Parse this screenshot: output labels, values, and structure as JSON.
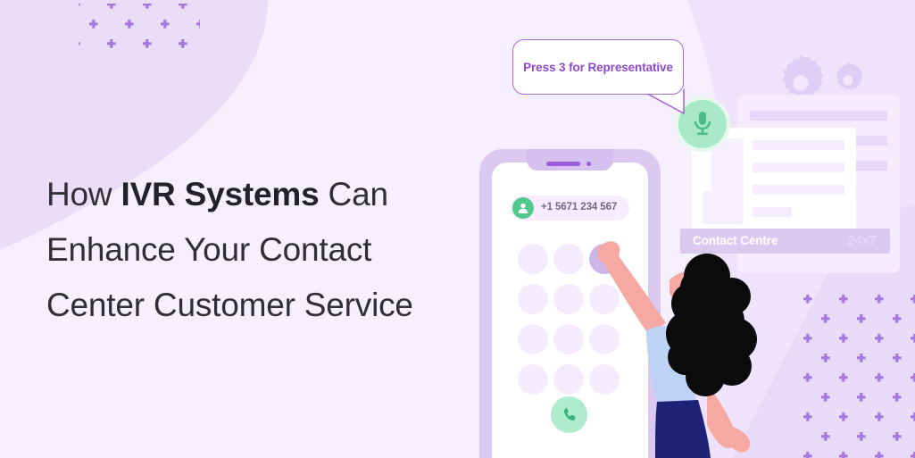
{
  "banner": {
    "headline": {
      "part1": "How ",
      "highlight": "IVR Systems",
      "part2": " Can Enhance Your Contact Center Customer Service"
    }
  },
  "speech_bubble": {
    "text": "Press 3 for Representative",
    "border_color": "#a66ad6",
    "text_color": "#8e49c8"
  },
  "phone": {
    "caller_number": "+1 5671 234 567",
    "avatar_icon": "user-icon",
    "call_icon": "phone-handset-icon",
    "keypad": {
      "rows": 4,
      "columns": 3,
      "active_key_index": 2
    }
  },
  "mic": {
    "icon": "microphone-icon",
    "circle_color": "#a9e9ca"
  },
  "contact_centre": {
    "title": "Contact Centre",
    "badge": "24x7",
    "bar_color": "#dbc9f0"
  },
  "card_front": {
    "lines": [
      110,
      110,
      110,
      46
    ]
  },
  "card_back": {
    "lines": [
      154,
      154,
      154
    ]
  },
  "colors": {
    "background": "#f6efff",
    "background_shade": "#e9ddf7",
    "accent_purple": "#9a5fd6",
    "mint": "#aeebcf",
    "green": "#4fc98c",
    "skin": "#f6a8a3",
    "hair": "#0b0b0b",
    "top": "#bdd2f5",
    "skirt": "#1e2277",
    "dot": "#a478dd"
  }
}
